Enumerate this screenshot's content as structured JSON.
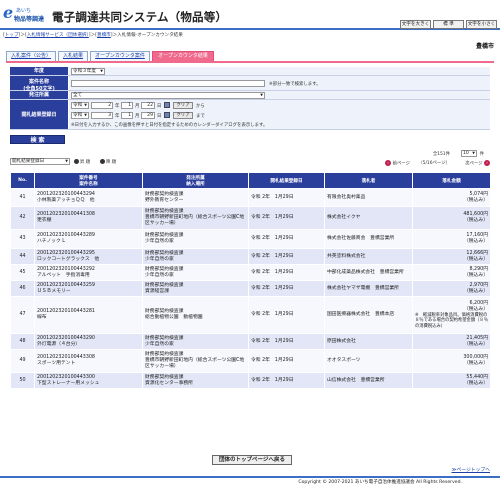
{
  "header": {
    "logo_small": "あいち",
    "logo_main": "物品等調達",
    "title": "電子調達共同システム（物品等）",
    "btn_font_large": "文字を大きく",
    "btn_font_normal": "標 準",
    "btn_font_small": "文字を小さく"
  },
  "breadcrumb": {
    "top": "トップ",
    "service": "入札情報サービス（団体選択）",
    "area": "豊橋市",
    "current": "＞入札情報-オープンカウンタ結果"
  },
  "area_name": "豊橋市",
  "tabs": [
    {
      "label": "入札案件（公告）"
    },
    {
      "label": "入札結果"
    },
    {
      "label": "オープンカウンタ案件"
    },
    {
      "label": "オープンカウンタ結果"
    }
  ],
  "form": {
    "year_label": "年度",
    "year_value": "令和３年度",
    "case_label": "案件名称",
    "case_sub": "(全角50文字)",
    "case_note": "※部分一致で検索します。",
    "order_label": "発注所属",
    "order_value": "全て",
    "date_label": "開札結果登録日",
    "era": "令和",
    "from_year": "2",
    "from_month": "1",
    "from_day": "22",
    "to_year": "3",
    "to_month": "1",
    "to_day": "29",
    "y": "年",
    "m": "月",
    "d": "日",
    "clear": "クリア",
    "from_text": "から",
    "to_text": "まで",
    "cal_note": "※日付を入力するか、この画像を押すと日付を指定するためのカレンダーダイアログを表示します。",
    "search_btn": "検 索"
  },
  "sort": {
    "value": "開札結果登録日",
    "asc": "昇 順",
    "desc": "降 順"
  },
  "pager": {
    "count_text": "全151件",
    "per_page": "10",
    "per_unit": "件",
    "next": "次ページ",
    "prev": "前ページ",
    "page_info": "（5/16ページ）"
  },
  "table": {
    "headers": {
      "no": "No.",
      "case": "案件番号",
      "case2": "案件名称",
      "order": "発注所属",
      "order2": "納入場所",
      "date": "開札結果登録日",
      "winner": "落札者",
      "amount": "落札金額"
    },
    "rows": [
      {
        "no": "41",
        "id": "2001202320100443294",
        "name": "小林製薬アッチョＱＱ　他",
        "org": "財務部契約検査課",
        "place": "野外教育センター",
        "date": "令和 2年　1月29日",
        "winner": "有限会社奥村薬品",
        "amount": "5,074円",
        "tax": "（税込み）"
      },
      {
        "no": "42",
        "id": "2001202320100441308",
        "name": "更衣棚",
        "org": "財務部契約検査課",
        "place": "豊橋市朝野新田町地内（総合スポーツ公園C地区サッカー場）",
        "date": "令和 2年　1月29日",
        "winner": "株式会社イクヤ",
        "amount": "481,600円",
        "tax": "（税込み）"
      },
      {
        "no": "43",
        "id": "2001202320100443289",
        "name": "ハチノック L",
        "org": "財務部契約検査課",
        "place": "少年自然の家",
        "date": "令和 2年　1月29日",
        "winner": "株式会社佐藤商会　豊橋営業所",
        "amount": "17,160円",
        "tax": "（税込み）"
      },
      {
        "no": "44",
        "id": "2001202320100443295",
        "name": "ロックコートグラックス　他",
        "org": "財務部契約検査課",
        "place": "少年自然の家",
        "date": "令和 2年　1月29日",
        "winner": "共英塗料株式会社",
        "amount": "12,666円",
        "tax": "（税込み）"
      },
      {
        "no": "45",
        "id": "2001202320100443292",
        "name": "アルペット　手指消毒用",
        "org": "財務部契約検査課",
        "place": "少年自然の家",
        "date": "令和 2年　1月29日",
        "winner": "中部化成薬品株式会社　豊橋営業所",
        "amount": "8,290円",
        "tax": "（税込み）"
      },
      {
        "no": "46",
        "id": "2001202320100443259",
        "name": "ＵＳＢメモリー",
        "org": "財務部契約検査課",
        "place": "資源経営課",
        "date": "令和 2年　1月29日",
        "winner": "株式会社ヤマザ電機　豊橋営業所",
        "amount": "2,970円",
        "tax": "（税込み）"
      },
      {
        "no": "47",
        "id": "2001202320100443281",
        "name": "線布",
        "org": "財務部契約検査課",
        "place": "総合動植物公園　動植物園",
        "date": "令和 2年　1月29日",
        "winner": "国田医療器株式会社　豊橋本店",
        "amount": "6,200円",
        "tax": "（税込み）",
        "note": "※　軽減税率対象品目。価格消費税の８％である場合の契約希望金額（８％の消費税込み）"
      },
      {
        "no": "48",
        "id": "2001202320100443290",
        "name": "外灯電源（４台分）",
        "org": "財務部契約検査課",
        "place": "少年自然の家",
        "date": "令和 2年　1月29日",
        "winner": "原田株式会社",
        "amount": "21,405円",
        "tax": "（税込み）"
      },
      {
        "no": "49",
        "id": "2001202320100443308",
        "name": "スポーツ用テント",
        "org": "財務部契約検査課",
        "place": "豊橋市朝野新田町地内（総合スポーツ公園C地区サッカー場）",
        "date": "令和 2年　1月29日",
        "winner": "オオタスポーツ",
        "amount": "300,000円",
        "tax": "（税込み）"
      },
      {
        "no": "50",
        "id": "2001202320100443300",
        "name": "下型ストレーナー用メッシュ",
        "org": "財務部契約検査課",
        "place": "資源化センター事務所",
        "date": "令和 2年　1月29日",
        "winner": "山信株式会社　豊橋営業所",
        "amount": "55,440円",
        "tax": "（税込み）"
      }
    ]
  },
  "bottom_btn": "団体のトップページへ戻る",
  "top_link": "≫ページトップへ",
  "footer": "Copyright © 2007-2021 あいち電子自治体推進協議会 All Rights Reserved."
}
